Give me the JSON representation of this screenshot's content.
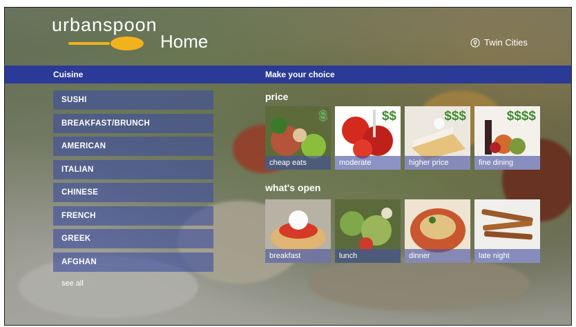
{
  "app": {
    "logo_text": "urbanspoon",
    "page_title": "Home",
    "location": "Twin Cities"
  },
  "band": {
    "cuisine_label": "Cuisine",
    "choice_label": "Make your choice"
  },
  "cuisine": {
    "items": [
      {
        "label": "SUSHI"
      },
      {
        "label": "BREAKFAST/BRUNCH"
      },
      {
        "label": "AMERICAN"
      },
      {
        "label": "ITALIAN"
      },
      {
        "label": "CHINESE"
      },
      {
        "label": "FRENCH"
      },
      {
        "label": "GREEK"
      },
      {
        "label": "AFGHAN"
      }
    ],
    "see_all": "see all"
  },
  "price": {
    "heading": "price",
    "tiles": [
      {
        "label": "cheap eats",
        "dollars": "$"
      },
      {
        "label": "moderate",
        "dollars": "$$"
      },
      {
        "label": "higher price",
        "dollars": "$$$"
      },
      {
        "label": "fine dining",
        "dollars": "$$$$"
      }
    ]
  },
  "open": {
    "heading": "what's open",
    "tiles": [
      {
        "label": "breakfast"
      },
      {
        "label": "lunch"
      },
      {
        "label": "dinner"
      },
      {
        "label": "late night"
      }
    ]
  },
  "colors": {
    "band": "#2b3a96",
    "tile_caption": "#4650a0",
    "dollar_green": "#3f8a2c",
    "spoon": "#f2b21c"
  },
  "icons": {
    "logo": "spoon-logo-icon",
    "location": "map-pin-icon"
  }
}
